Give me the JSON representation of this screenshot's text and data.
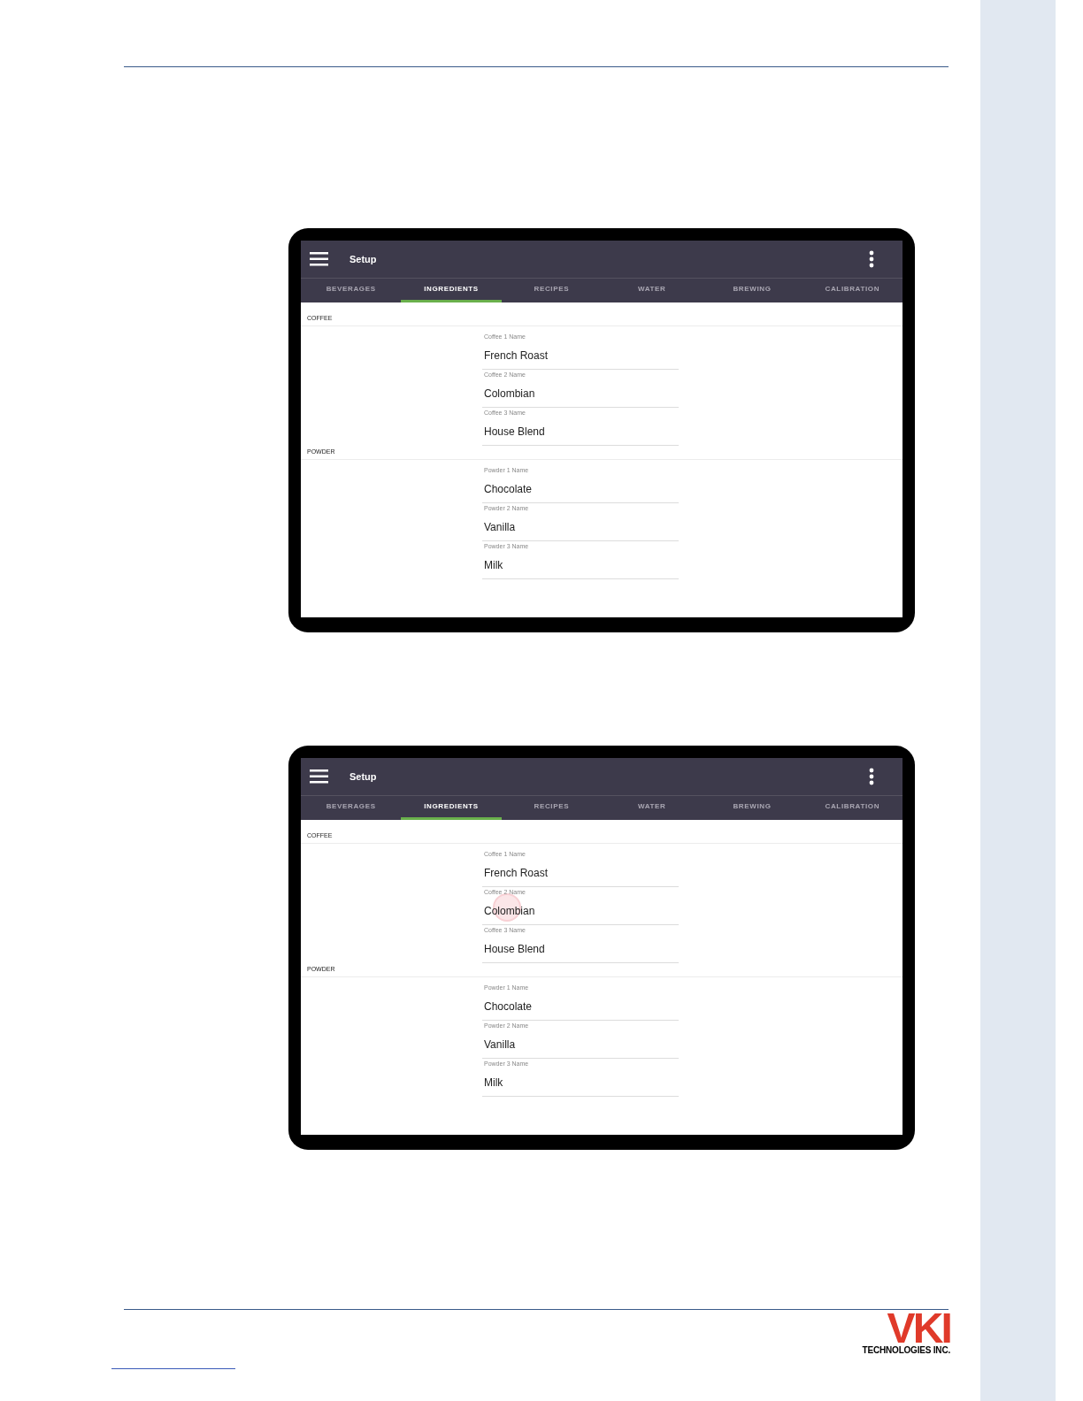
{
  "screens": [
    {
      "app_bar": {
        "title": "Setup"
      },
      "tabs": [
        {
          "label": "BEVERAGES",
          "selected": false
        },
        {
          "label": "INGREDIENTS",
          "selected": true
        },
        {
          "label": "RECIPES",
          "selected": false
        },
        {
          "label": "WATER",
          "selected": false
        },
        {
          "label": "BREWING",
          "selected": false
        },
        {
          "label": "CALIBRATION",
          "selected": false
        }
      ],
      "sections": [
        {
          "label": "COFFEE",
          "fields": [
            {
              "label": "Coffee 1 Name",
              "value": "French Roast",
              "touched": false
            },
            {
              "label": "Coffee 2 Name",
              "value": "Colombian",
              "touched": false
            },
            {
              "label": "Coffee 3 Name",
              "value": "House Blend",
              "touched": false
            }
          ]
        },
        {
          "label": "POWDER",
          "fields": [
            {
              "label": "Powder 1 Name",
              "value": "Chocolate",
              "touched": false
            },
            {
              "label": "Powder 2 Name",
              "value": "Vanilla",
              "touched": false
            },
            {
              "label": "Powder 3 Name",
              "value": "Milk",
              "touched": false
            }
          ]
        }
      ]
    },
    {
      "app_bar": {
        "title": "Setup"
      },
      "tabs": [
        {
          "label": "BEVERAGES",
          "selected": false
        },
        {
          "label": "INGREDIENTS",
          "selected": true
        },
        {
          "label": "RECIPES",
          "selected": false
        },
        {
          "label": "WATER",
          "selected": false
        },
        {
          "label": "BREWING",
          "selected": false
        },
        {
          "label": "CALIBRATION",
          "selected": false
        }
      ],
      "sections": [
        {
          "label": "COFFEE",
          "fields": [
            {
              "label": "Coffee 1 Name",
              "value": "French Roast",
              "touched": false
            },
            {
              "label": "Coffee 2 Name",
              "value": "Colombian",
              "touched": true
            },
            {
              "label": "Coffee 3 Name",
              "value": "House Blend",
              "touched": false
            }
          ]
        },
        {
          "label": "POWDER",
          "fields": [
            {
              "label": "Powder 1 Name",
              "value": "Chocolate",
              "touched": false
            },
            {
              "label": "Powder 2 Name",
              "value": "Vanilla",
              "touched": false
            },
            {
              "label": "Powder 3 Name",
              "value": "Milk",
              "touched": false
            }
          ]
        }
      ]
    }
  ],
  "logo": {
    "mark": "VKI",
    "company": "TECHNOLOGIES INC."
  }
}
